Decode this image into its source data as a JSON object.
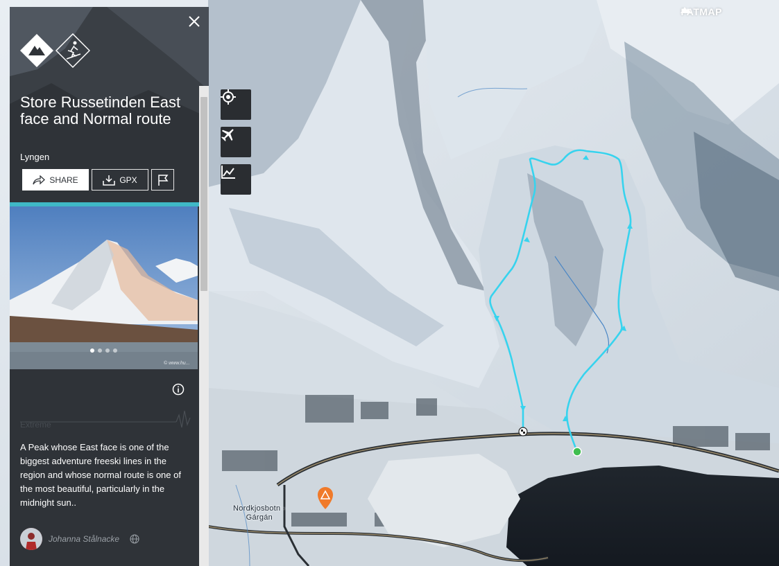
{
  "brand": {
    "name": "FATMAP"
  },
  "route": {
    "title": "Store Russetinden East face and Normal route",
    "region": "Lyngen",
    "difficulty": "Extreme",
    "description": "A Peak whose East face is one of the biggest adventure freeski lines in the region and whose normal route is one of the most beautiful, particularly in the midnight sun..",
    "author": "Johanna Stålnacke"
  },
  "actions": {
    "share_label": "SHARE",
    "gpx_label": "GPX"
  },
  "photo": {
    "watermark": "© www.hu...",
    "dot_count": 4,
    "active_dot": 1
  },
  "map": {
    "place_label_line1": "Nordkjosbotn -",
    "place_label_line2": "Gárgán",
    "route_color": "#37d3ee",
    "start_color": "#3fbe4f",
    "campsite_color": "#f07a2a"
  },
  "colors": {
    "accent": "#3fb8c6",
    "panel": "#2f3338"
  },
  "icons": [
    "close-icon",
    "mountain-badge-icon",
    "ski-tour-badge-icon",
    "share-icon",
    "download-icon",
    "flag-icon",
    "locate-icon",
    "plane-icon",
    "elevation-profile-icon",
    "info-icon",
    "globe-icon",
    "campsite-marker-icon",
    "start-marker-icon",
    "finish-marker-icon"
  ]
}
